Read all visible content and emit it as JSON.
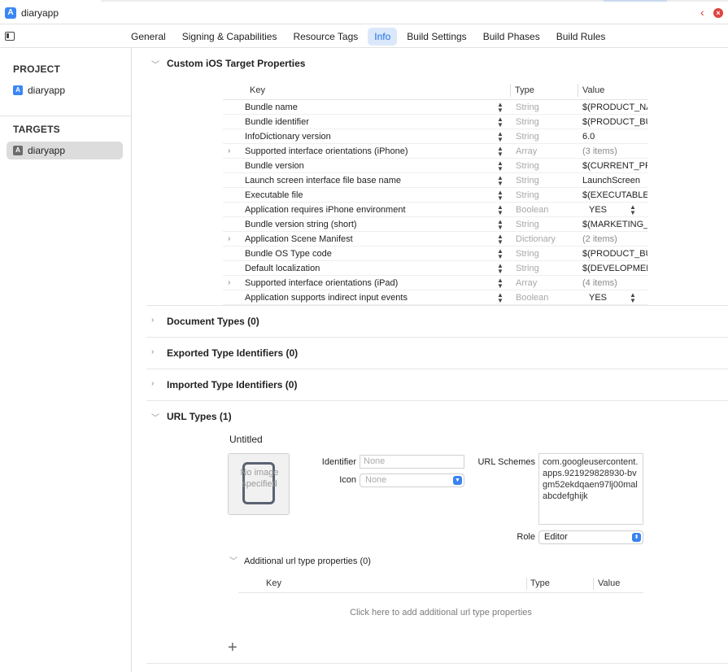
{
  "window": {
    "title": "diaryapp"
  },
  "tabs": [
    {
      "label": "General",
      "active": false
    },
    {
      "label": "Signing & Capabilities",
      "active": false
    },
    {
      "label": "Resource Tags",
      "active": false
    },
    {
      "label": "Info",
      "active": true
    },
    {
      "label": "Build Settings",
      "active": false
    },
    {
      "label": "Build Phases",
      "active": false
    },
    {
      "label": "Build Rules",
      "active": false
    }
  ],
  "sidebar": {
    "project_header": "PROJECT",
    "project_item": "diaryapp",
    "targets_header": "TARGETS",
    "target_item": "diaryapp"
  },
  "sections": {
    "custom_ios": "Custom iOS Target Properties",
    "document_types": "Document Types (0)",
    "exported_types": "Exported Type Identifiers (0)",
    "imported_types": "Imported Type Identifiers (0)",
    "url_types": "URL Types (1)"
  },
  "props_table": {
    "headers": {
      "key": "Key",
      "type": "Type",
      "value": "Value"
    },
    "rows": [
      {
        "key": "Bundle name",
        "type": "String",
        "value": "$(PRODUCT_NAME)",
        "expandable": false
      },
      {
        "key": "Bundle identifier",
        "type": "String",
        "value": "$(PRODUCT_BUNDLE_IDENTIFIER)",
        "expandable": false
      },
      {
        "key": "InfoDictionary version",
        "type": "String",
        "value": "6.0",
        "expandable": false
      },
      {
        "key": "Supported interface orientations (iPhone)",
        "type": "Array",
        "value": "(3 items)",
        "expandable": true
      },
      {
        "key": "Bundle version",
        "type": "String",
        "value": "$(CURRENT_PROJECT_VERSION)",
        "expandable": false
      },
      {
        "key": "Launch screen interface file base name",
        "type": "String",
        "value": "LaunchScreen",
        "expandable": false
      },
      {
        "key": "Executable file",
        "type": "String",
        "value": "$(EXECUTABLE_NAME)",
        "expandable": false
      },
      {
        "key": "Application requires iPhone environment",
        "type": "Boolean",
        "value": "YES",
        "expandable": false
      },
      {
        "key": "Bundle version string (short)",
        "type": "String",
        "value": "$(MARKETING_VERSION)",
        "expandable": false
      },
      {
        "key": "Application Scene Manifest",
        "type": "Dictionary",
        "value": "(2 items)",
        "expandable": true
      },
      {
        "key": "Bundle OS Type code",
        "type": "String",
        "value": "$(PRODUCT_BUNDLE_PACKAGE_TYPE)",
        "expandable": false
      },
      {
        "key": "Default localization",
        "type": "String",
        "value": "$(DEVELOPMENT_LANGUAGE)",
        "expandable": false
      },
      {
        "key": "Supported interface orientations (iPad)",
        "type": "Array",
        "value": "(4 items)",
        "expandable": true
      },
      {
        "key": "Application supports indirect input events",
        "type": "Boolean",
        "value": "YES",
        "expandable": false
      }
    ]
  },
  "url_type": {
    "name": "Untitled",
    "image_placeholder": "No image specified",
    "identifier_label": "Identifier",
    "identifier_placeholder": "None",
    "icon_label": "Icon",
    "icon_value": "None",
    "schemes_label": "URL Schemes",
    "schemes_value": "com.googleusercontent.apps.921929828930-bvgm52ekdqaen97lj00malabcdefghijk",
    "role_label": "Role",
    "role_value": "Editor",
    "additional_label": "Additional url type properties (0)",
    "additional_headers": {
      "key": "Key",
      "type": "Type",
      "value": "Value"
    },
    "add_hint": "Click here to add additional url type properties",
    "add_symbol": "+"
  }
}
